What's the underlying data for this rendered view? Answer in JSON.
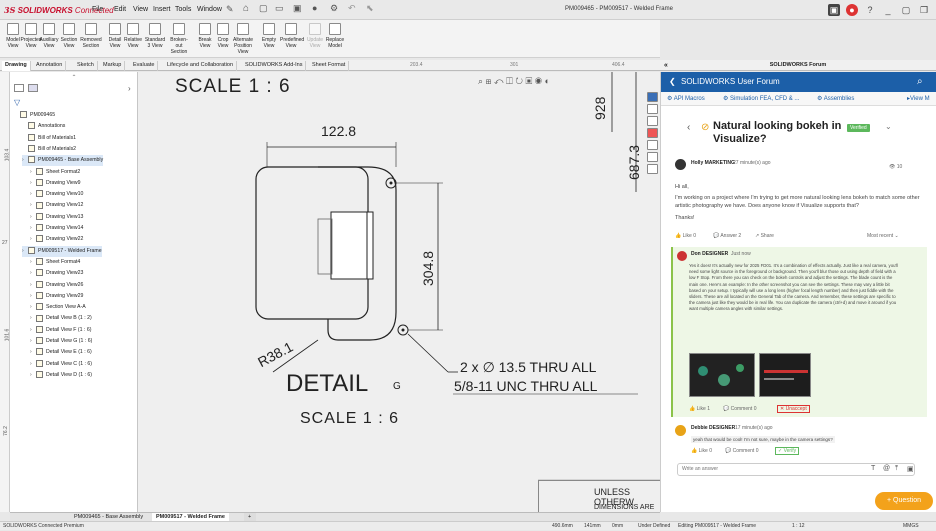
{
  "app": {
    "brand_ds": "3S",
    "brand_name": "SOLIDWORKS",
    "brand_suffix": "Connected",
    "document_title": "PM009465 - PM009517 - Welded Frame",
    "menu": [
      "File",
      "Edit",
      "View",
      "Insert",
      "Tools",
      "Window"
    ]
  },
  "ribbon": {
    "tools": [
      {
        "label": "Model View"
      },
      {
        "label": "Projected View"
      },
      {
        "label": "Auxiliary View"
      },
      {
        "label": "Section View"
      },
      {
        "label": "Removed Section"
      },
      {
        "label": "Detail View"
      },
      {
        "label": "Relative View"
      },
      {
        "label": "Standard 3 View"
      },
      {
        "label": "Broken-out Section"
      },
      {
        "label": "Break View"
      },
      {
        "label": "Crop View"
      },
      {
        "label": "Alternate Position View"
      },
      {
        "label": "Empty View"
      },
      {
        "label": "Predefined View"
      },
      {
        "label": "Update View"
      },
      {
        "label": "Replace Model"
      }
    ]
  },
  "tabs": [
    "Drawing",
    "Annotation",
    "Sketch",
    "Markup",
    "Evaluate",
    "Lifecycle and Collaboration",
    "SOLIDWORKS Add-Ins",
    "Sheet Format"
  ],
  "ruler": {
    "a": "203.4",
    "b": "301",
    "c": "406.4"
  },
  "vruler": {
    "a": "103.4",
    "b": "27",
    "c": "101.6",
    "d": "76.2"
  },
  "tree": {
    "items": [
      {
        "label": "PM009465",
        "level": 0
      },
      {
        "label": "Annotations",
        "level": 1
      },
      {
        "label": "Bill of Materials1",
        "level": 1
      },
      {
        "label": "Bill of Materials2",
        "level": 1
      },
      {
        "label": "PM009465 - Base Assembly",
        "level": 1
      },
      {
        "label": "Sheet Format2",
        "level": 2
      },
      {
        "label": "Drawing View9",
        "level": 2
      },
      {
        "label": "Drawing View10",
        "level": 2
      },
      {
        "label": "Drawing View12",
        "level": 2
      },
      {
        "label": "Drawing View13",
        "level": 2
      },
      {
        "label": "Drawing View14",
        "level": 2
      },
      {
        "label": "Drawing View22",
        "level": 2
      },
      {
        "label": "PM009517 - Welded Frame",
        "level": 1
      },
      {
        "label": "Sheet Format4",
        "level": 2
      },
      {
        "label": "Drawing View23",
        "level": 2
      },
      {
        "label": "Drawing View26",
        "level": 2
      },
      {
        "label": "Drawing View29",
        "level": 2
      },
      {
        "label": "Section View A-A",
        "level": 2
      },
      {
        "label": "Detail View B (1 : 2)",
        "level": 2
      },
      {
        "label": "Detail View F (1 : 6)",
        "level": 2
      },
      {
        "label": "Detail View G (1 : 6)",
        "level": 2
      },
      {
        "label": "Detail View E (1 : 6)",
        "level": 2
      },
      {
        "label": "Detail View C (1 : 6)",
        "level": 2
      },
      {
        "label": "Detail View D (1 : 6)",
        "level": 2
      }
    ]
  },
  "drawing": {
    "scale_top": "SCALE 1 : 6",
    "dim_122": "122.8",
    "dim_928": "928",
    "dim_687": "687.3",
    "dim_304": "304.8",
    "dim_r38": "R38.1",
    "note_line1": "2 x ∅ 13.5 THRU ALL",
    "note_line2": "5/8-11 UNC  THRU ALL",
    "detail_title": "DETAIL",
    "detail_letter": "G",
    "detail_scale": "SCALE 1 : 6",
    "unless": "UNLESS OTHERW",
    "dimensions": "DIMENSIONS ARE"
  },
  "sheet_tabs": [
    "PM009465 - Base Assembly",
    "PM009517 - Welded Frame"
  ],
  "status": {
    "left": "SOLIDWORKS Connected Premium",
    "x": "490.6mm",
    "y": "141mm",
    "z": "0mm",
    "state": "Under Defined",
    "editing": "Editing PM009517 - Welded Frame",
    "scale": "1 : 12",
    "units": "MMGS"
  },
  "forum": {
    "pane_title": "SOLIDWORKS Forum",
    "header": "SOLIDWORKS User Forum",
    "nav": [
      "API Macros",
      "Simulation FEA, CFD & ...",
      "Assemblies",
      "View M"
    ],
    "question_title": "Natural looking bokeh in Visualize?",
    "verified": "Verified",
    "author1": "Holly MARKETING",
    "author1_time": "27 minute(s) ago",
    "views": "10",
    "greeting": "Hi all,",
    "question_body": "I'm working on a project where I'm trying to get more natural looking lens bokeh to match some other artistic photography we have. Does anyone know if Visualize supports that?",
    "thanks": "Thanks!",
    "like": "Like",
    "like_count": "0",
    "answer_label": "Answer",
    "answer_count": "2",
    "share": "Share",
    "most_recent": "Most recent",
    "reply_author": "Don DESIGNER",
    "reply_time": "Just now",
    "reply_body": "Yes it does! It's actually new for 2025 FD01. It's a combination of effects actually. Just like a real camera, you'll need some light source in the foreground or background. Then you'll blur those out using depth of field with a low F Stop. From there you can check on the bokeh controls and adjust the settings. The blade count is the main one. Here's an example: In the other screenshot you can see the settings. These may vary a little bit based on your setup. I typically will use a long lens (higher focal length number) and then just fiddle with the sliders. These are all located on the General Tab of the camera. And remember, these settings are specific to the camera just like they would be in real life. You can duplicate the camera (ctrl+d) and move it around if you want multiple camera angles with similar settings.",
    "reply_like_count": "1",
    "reply_comment_label": "Comment",
    "reply_comment_count": "0",
    "unaccept": "Unaccept",
    "author3": "Debbie DESIGNER",
    "author3_time": "17 minute(s) ago",
    "comment_body": "yeah that would be cool! I'm not sure, maybe in the camera settings?",
    "c_like_count": "0",
    "c_comment_count": "0",
    "verify": "Verify",
    "add_answer_placeholder": "Write an answer",
    "question_button": "Question"
  },
  "colors": {
    "forum_blue": "#1c5fa8",
    "verified_green": "#5cb85c",
    "question_orange": "#f3a21b",
    "brand_red": "#c8102e"
  }
}
